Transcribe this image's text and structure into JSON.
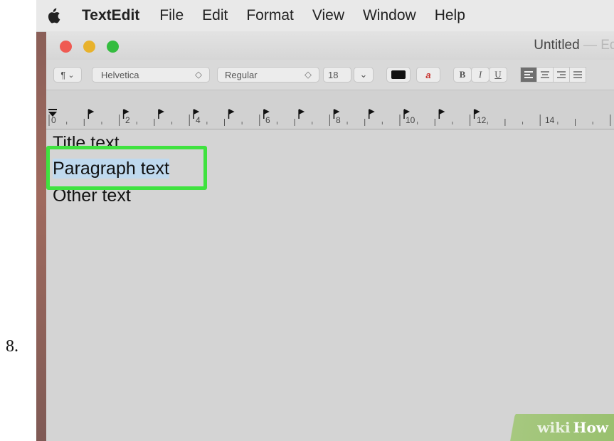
{
  "step": {
    "number": "8."
  },
  "menubar": {
    "app_name": "TextEdit",
    "items": [
      "File",
      "Edit",
      "Format",
      "View",
      "Window",
      "Help"
    ]
  },
  "window": {
    "title": "Untitled",
    "title_suffix": " — Edit"
  },
  "toolbar": {
    "paragraph_label": "¶",
    "font_name": "Helvetica",
    "font_style": "Regular",
    "font_size": "18",
    "chevron_updown": "⌃",
    "chevron_down": "⌄",
    "bg_color_glyph": "a",
    "bold_label": "B",
    "italic_label": "I",
    "underline_label": "U",
    "alignment_selected": "left",
    "text_color": "#111111"
  },
  "ruler": {
    "labels": [
      "0",
      "2",
      "4",
      "6",
      "8",
      "10",
      "12",
      "14"
    ]
  },
  "document": {
    "lines": [
      "Title text",
      "Paragraph text",
      "Other text"
    ],
    "selected_line": "Paragraph text",
    "highlight_color": "#3fe23f",
    "selection_color": "#bfd9ee"
  },
  "watermark": {
    "wiki": "wiki",
    "how": "How"
  }
}
